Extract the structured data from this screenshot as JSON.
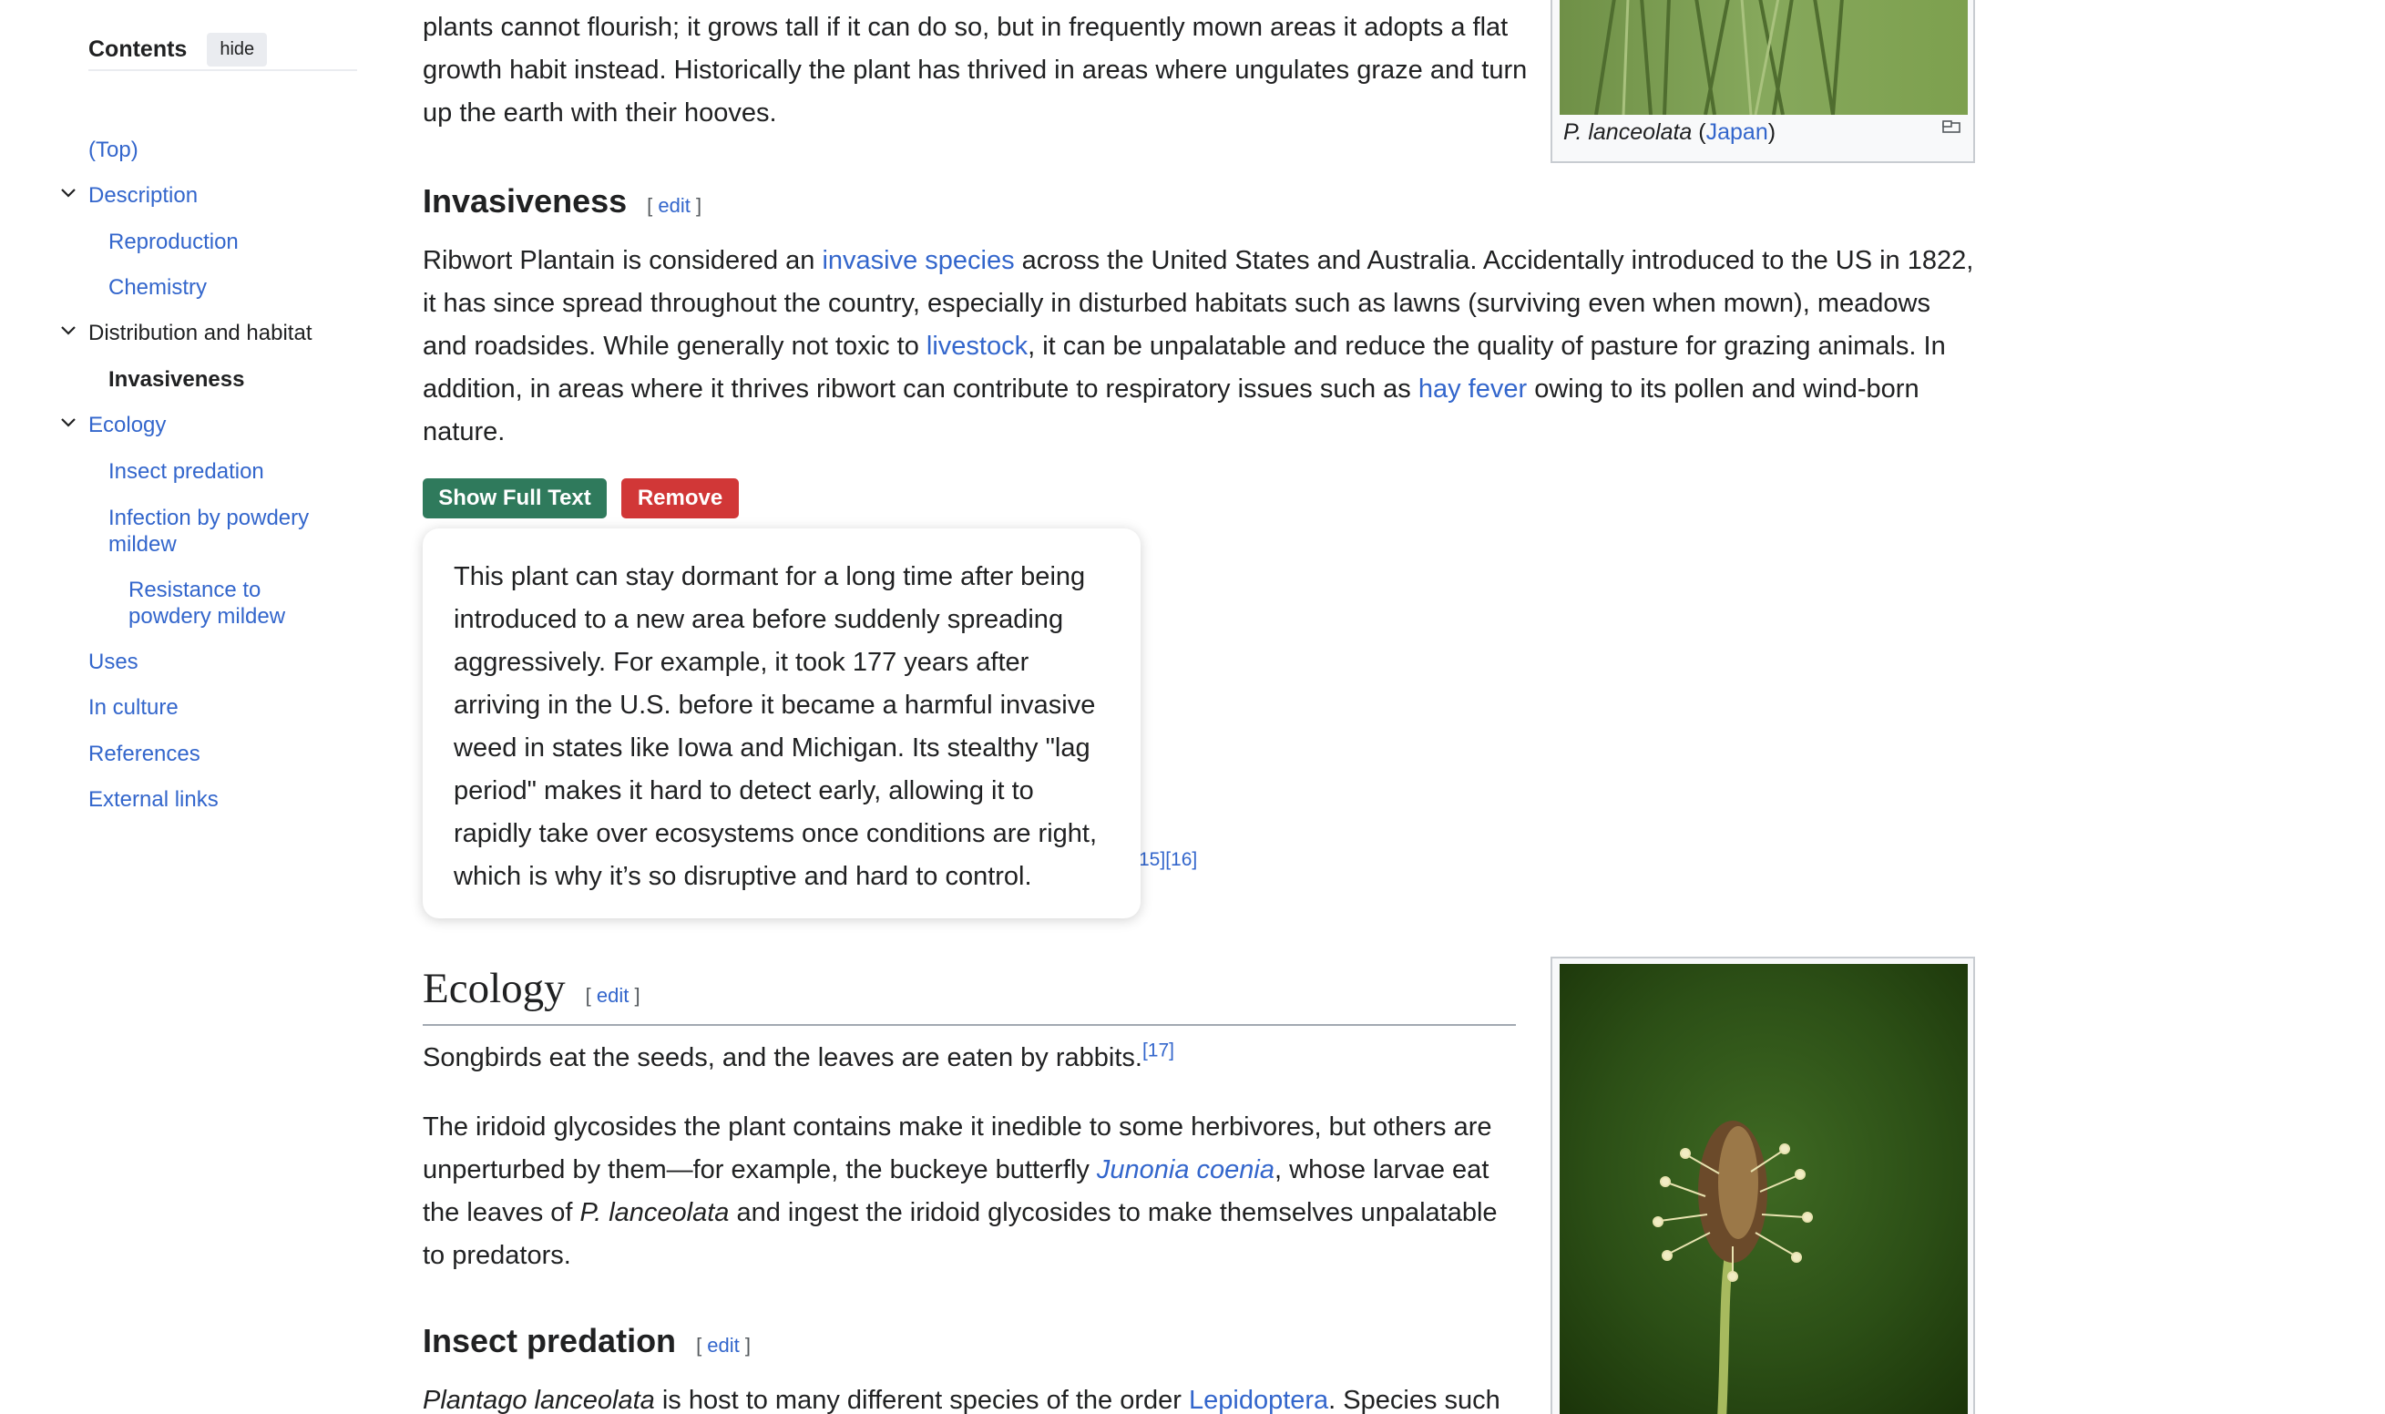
{
  "toc": {
    "title": "Contents",
    "hide_label": "hide",
    "items": [
      {
        "label": "(Top)"
      },
      {
        "label": "Description"
      },
      {
        "label": "Reproduction"
      },
      {
        "label": "Chemistry"
      },
      {
        "label": "Distribution and habitat"
      },
      {
        "label": "Invasiveness"
      },
      {
        "label": "Ecology"
      },
      {
        "label": "Insect predation"
      },
      {
        "label": "Infection by powdery mildew"
      },
      {
        "label": "Resistance to powdery mildew"
      },
      {
        "label": "Uses"
      },
      {
        "label": "In culture"
      },
      {
        "label": "References"
      },
      {
        "label": "External links"
      }
    ]
  },
  "top_para": {
    "text": "plants cannot flourish; it grows tall if it can do so, but in frequently mown areas it adopts a flat growth habit instead. Historically the plant has thrived in areas where ungulates graze and turn up the earth with their hooves."
  },
  "figure_top": {
    "caption_italic": "P. lanceolata",
    "caption_open": " (",
    "caption_link": "Japan",
    "caption_close": ")"
  },
  "invasiveness": {
    "heading": "Invasiveness",
    "edit": "edit",
    "p1": "Ribwort Plantain is considered an ",
    "link1": "invasive species",
    "p2": " across the United States and Australia. Accidentally introduced to the US in 1822, it has since spread throughout the country, especially in disturbed habitats such as lawns (surviving even when mown), meadows and roadsides. While generally not toxic to ",
    "link2": "livestock",
    "p3": ", it can be unpalatable and reduce the quality of pasture for grazing animals. In addition, in areas where it thrives ribwort can contribute to respiratory issues such as ",
    "link3": "hay fever",
    "p4": " owing to its pollen and wind-born nature."
  },
  "buttons": {
    "show_full_text": "Show Full Text",
    "remove": "Remove"
  },
  "card": {
    "text": "This plant can stay dormant for a long time after being introduced to a new area before suddenly spreading aggressively. For example, it took 177 years after arriving in the U.S. before it became a harmful invasive weed in states like Iowa and Michigan. Its stealthy \"lag period\" makes it hard to detect early, allowing it to rapidly take over ecosystems once conditions are right, which is why it’s so disruptive and hard to control."
  },
  "hidden_refs": "15][16]",
  "ecology": {
    "heading": "Ecology",
    "edit": "edit",
    "p1": "Songbirds eat the seeds, and the leaves are eaten by rabbits.",
    "ref1": "[17]",
    "p2a": "The iridoid glycosides the plant contains make it inedible to some herbivores, but others are unperturbed by them—for example, the buckeye butterfly ",
    "p2_link": "Junonia coenia",
    "p2b": ", whose larvae eat the leaves of ",
    "p2_italic": "P. lanceolata",
    "p2c": " and ingest the iridoid glycosides to make themselves unpalatable to predators."
  },
  "insect_predation": {
    "heading": "Insect predation",
    "edit": "edit",
    "p_italic": "Plantago lanceolata",
    "p1": " is host to many different species of the order ",
    "p_link": "Lepidoptera",
    "p2": ". Species such"
  },
  "colors": {
    "link": "#3366cc",
    "show_button": "#2f7a5c",
    "remove_button": "#d13737"
  }
}
